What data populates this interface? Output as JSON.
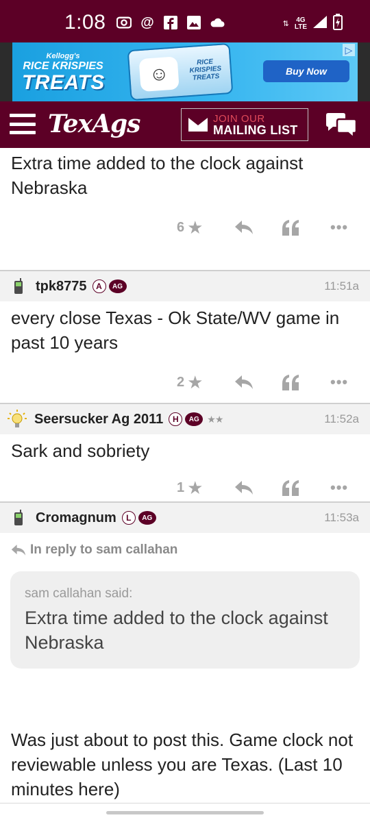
{
  "status_bar": {
    "time": "1:08",
    "network_top": "4G",
    "network_bottom": "LTE",
    "icons": [
      "radio-icon",
      "at-icon",
      "facebook-icon",
      "image-icon",
      "cloud-icon"
    ]
  },
  "ad": {
    "brand_small": "Kellogg's",
    "brand_line1": "RICE KRISPIES",
    "brand_line2": "TREATS",
    "product_label": "RICE KRISPIES TREATS",
    "cta": "Buy Now"
  },
  "header": {
    "logo": "TexAgs",
    "mailing_line1": "JOIN OUR",
    "mailing_line2": "MAILING LIST"
  },
  "posts": [
    {
      "body": "Extra time added to the clock against Nebraska",
      "star_count": "6"
    },
    {
      "username": "tpk8775",
      "badge_letter": "A",
      "badge_ag": "AG",
      "time": "11:51a",
      "body": "every close Texas - Ok State/WV game in past 10 years",
      "star_count": "2"
    },
    {
      "username": "Seersucker Ag 2011",
      "badge_letter": "H",
      "badge_ag": "AG",
      "rank_stars": "★★",
      "time": "11:52a",
      "body": "Sark and sobriety",
      "star_count": "1"
    },
    {
      "username": "Cromagnum",
      "badge_letter": "L",
      "badge_ag": "AG",
      "time": "11:53a",
      "reply_to": "In reply to sam callahan",
      "quote_author": "sam callahan said:",
      "quote_text": "Extra time added to the clock against Nebraska",
      "body": "Was just about to post this. Game clock not reviewable unless you are Texas. (Last 10 minutes here)"
    }
  ],
  "colors": {
    "brand_maroon": "#5c0026",
    "accent_red": "#e14a5a"
  }
}
